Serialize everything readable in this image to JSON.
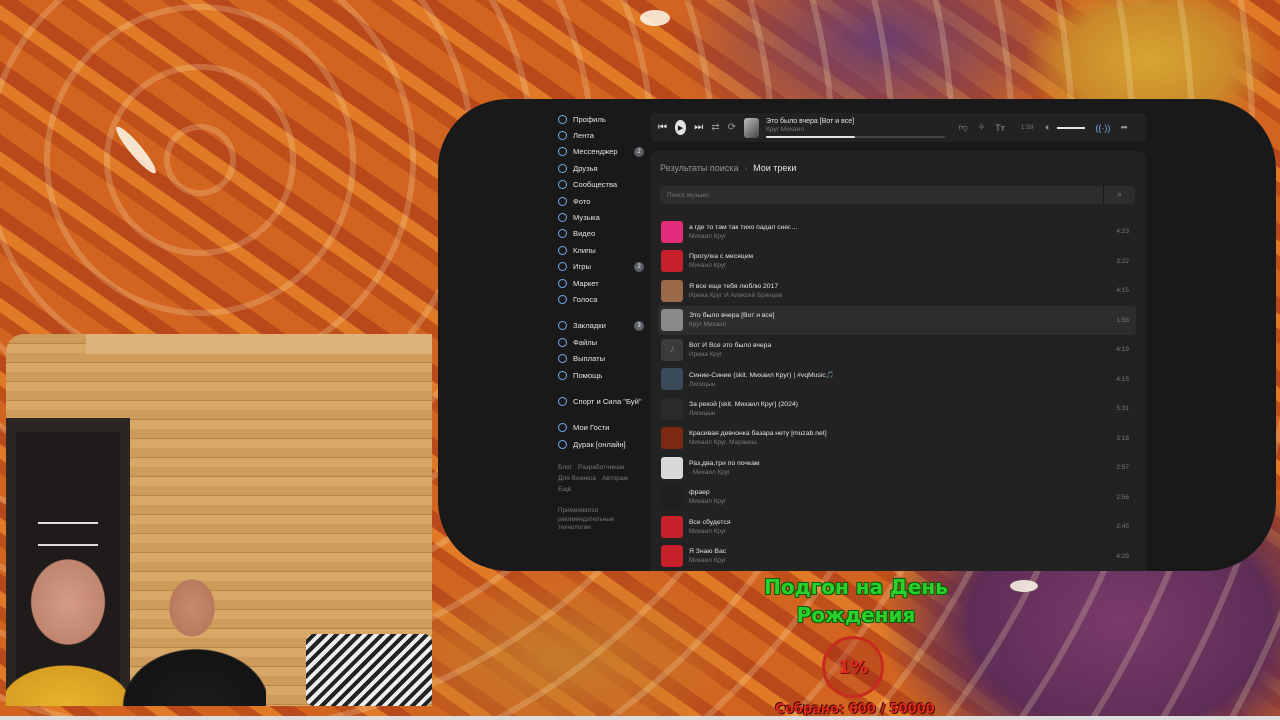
{
  "sidebar": {
    "items": [
      {
        "label": "Профиль",
        "icon": "user-icon",
        "badge": ""
      },
      {
        "label": "Лента",
        "icon": "news-icon",
        "badge": ""
      },
      {
        "label": "Мессенджер",
        "icon": "message-icon",
        "badge": "2"
      },
      {
        "label": "Друзья",
        "icon": "friends-icon",
        "badge": ""
      },
      {
        "label": "Сообщества",
        "icon": "groups-icon",
        "badge": ""
      },
      {
        "label": "Фото",
        "icon": "photo-icon",
        "badge": ""
      },
      {
        "label": "Музыка",
        "icon": "music-icon",
        "badge": ""
      },
      {
        "label": "Видео",
        "icon": "video-icon",
        "badge": ""
      },
      {
        "label": "Клипы",
        "icon": "clips-icon",
        "badge": ""
      },
      {
        "label": "Игры",
        "icon": "games-icon",
        "badge": "2"
      },
      {
        "label": "Маркет",
        "icon": "market-icon",
        "badge": ""
      },
      {
        "label": "Голоса",
        "icon": "votes-icon",
        "badge": ""
      }
    ],
    "items2": [
      {
        "label": "Закладки",
        "icon": "bookmark-icon",
        "badge": "3"
      },
      {
        "label": "Файлы",
        "icon": "files-icon",
        "badge": ""
      },
      {
        "label": "Выплаты",
        "icon": "payments-icon",
        "badge": ""
      },
      {
        "label": "Помощь",
        "icon": "help-icon",
        "badge": ""
      }
    ],
    "items3": [
      {
        "label": "Спорт и Сила \"Буй\"",
        "icon": "sport-group-icon"
      }
    ],
    "items4": [
      {
        "label": "Мои Гости",
        "icon": "guests-app-icon"
      },
      {
        "label": "Дурак [онлайн]",
        "icon": "cards-game-icon"
      }
    ],
    "footer_links": [
      "Блог",
      "Разработчикам",
      "Для бизнеса",
      "Авторам",
      "Ещё"
    ],
    "footer_note": "Применяются рекомендательные технологии"
  },
  "player": {
    "title": "Это было вчера [Вот и все]",
    "artist": "Круг Михаил",
    "time": "1:59",
    "progress": 0.5,
    "volume": 0.9
  },
  "content": {
    "breadcrumb_1": "Результаты поиска",
    "breadcrumb_2": "Мои треки",
    "search_placeholder": "Поиск музыки"
  },
  "tracks": [
    {
      "title": "а где то там так тихо падал снег....",
      "artist": "Михаил Круг",
      "duration": "4:23",
      "cover": "#e02a7a",
      "active": false
    },
    {
      "title": "Прогулка с месяцем",
      "artist": "Михаил Круг",
      "duration": "3:22",
      "cover": "#c8202a",
      "active": false
    },
    {
      "title": "Я все еще тебя люблю 2017",
      "artist": "Ирина Круг И Алексей Брянцев",
      "duration": "4:15",
      "cover": "#9a6a4a",
      "active": false
    },
    {
      "title": "Это было вчера [Вот и все]",
      "artist": "Круг Михаил",
      "duration": "1:58",
      "cover": "#8a8a8a",
      "active": true
    },
    {
      "title": "Вот И Все это было вчера",
      "artist": "Ирина Круг",
      "duration": "4:19",
      "cover": "#3a3b3c",
      "active": false
    },
    {
      "title": "Синие-Синие (skit. Михаил Круг) | #vqMusic🎵",
      "artist": "Лисицын",
      "duration": "4:15",
      "cover": "#3a4a5a",
      "active": false
    },
    {
      "title": "За рекой [skit. Михаил Круг] (2024)",
      "artist": "Лисицын",
      "duration": "5:31",
      "cover": "#2a2a2a",
      "active": false
    },
    {
      "title": "Красивая девчонка базара нету [muzab.net]",
      "artist": "Михаил Круг, Маракеш",
      "duration": "3:18",
      "cover": "#7a2a10",
      "active": false
    },
    {
      "title": "Раз,два,три по почкам",
      "artist": "- Михаил Круг",
      "duration": "2:57",
      "cover": "#d8d8d8",
      "active": false
    },
    {
      "title": "фраер",
      "artist": "Михаил Круг",
      "duration": "2:56",
      "cover": "#1e1e1e",
      "active": false
    },
    {
      "title": "Все сбудется",
      "artist": "Михаил Круг",
      "duration": "2:45",
      "cover": "#c8202a",
      "active": false
    },
    {
      "title": "Я Знаю Вас",
      "artist": "Михаил Круг",
      "duration": "4:29",
      "cover": "#c8202a",
      "active": false
    }
  ],
  "goal": {
    "title": "Подгон на День Рождения",
    "percent": "1%",
    "collected": "Собрано: 600 / 50000"
  }
}
